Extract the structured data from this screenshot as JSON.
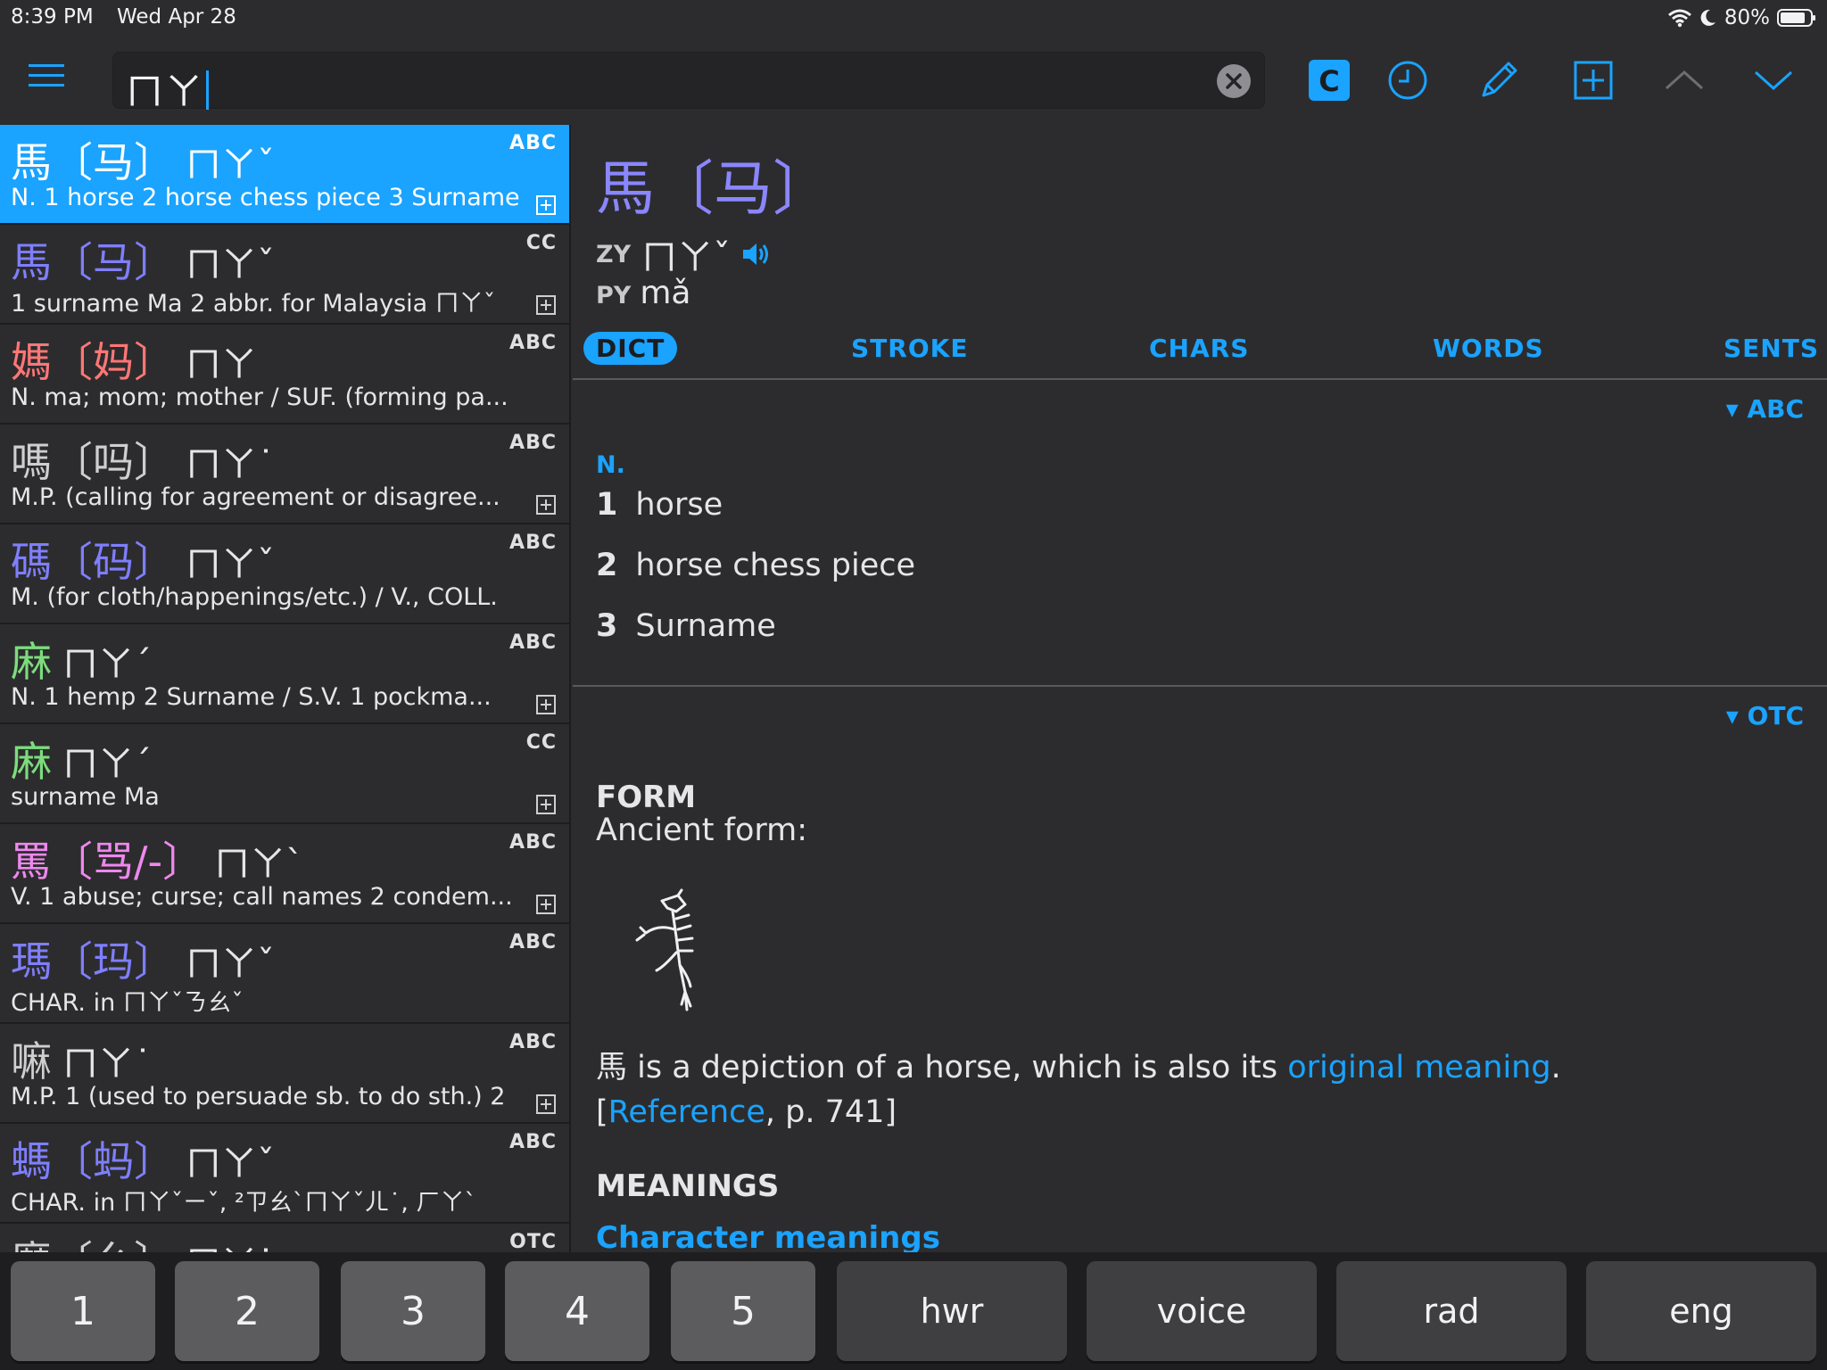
{
  "status": {
    "time": "8:39 PM",
    "date": "Wed Apr 28",
    "battery": "80%"
  },
  "search": {
    "query": "ㄇㄚ"
  },
  "toolbar": {
    "c_label": "C"
  },
  "list": [
    {
      "char": "馬",
      "simp": "〔马〕",
      "zy": "ㄇㄚˇ",
      "src": "ABC",
      "sub": "N. 1 horse 2 horse chess piece 3 Surname",
      "color": "blue",
      "selected": true,
      "add": true
    },
    {
      "char": "馬",
      "simp": "〔马〕",
      "zy": "ㄇㄚˇ",
      "src": "CC",
      "sub": "1 surname Ma 2 abbr. for Malaysia ㄇㄚˇ",
      "color": "blue",
      "add": true
    },
    {
      "char": "媽",
      "simp": "〔妈〕",
      "zy": "ㄇㄚ",
      "src": "ABC",
      "sub": "N. ma; mom; mother / SUF. (forming pa...",
      "color": "red",
      "add": false
    },
    {
      "char": "嗎",
      "simp": "〔吗〕",
      "zy": "ㄇㄚ˙",
      "src": "ABC",
      "sub": "M.P. (calling for agreement or disagree...",
      "color": "gray",
      "add": true
    },
    {
      "char": "碼",
      "simp": "〔码〕",
      "zy": "ㄇㄚˇ",
      "src": "ABC",
      "sub": "M. (for cloth/happenings/etc.) / V., COLL.",
      "color": "blue",
      "add": false
    },
    {
      "char": "麻",
      "simp": "",
      "zy": "ㄇㄚˊ",
      "src": "ABC",
      "sub": "N. 1 hemp 2 Surname / S.V. 1 pockma...",
      "color": "green",
      "add": true
    },
    {
      "char": "麻",
      "simp": "",
      "zy": "ㄇㄚˊ",
      "src": "CC",
      "sub": "surname Ma",
      "color": "green",
      "add": true
    },
    {
      "char": "罵",
      "simp": "〔骂/-〕",
      "zy": "ㄇㄚˋ",
      "src": "ABC",
      "sub": "V. 1 abuse; curse; call names 2 condem...",
      "color": "pink",
      "add": true
    },
    {
      "char": "瑪",
      "simp": "〔玛〕",
      "zy": "ㄇㄚˇ",
      "src": "ABC",
      "sub": "CHAR. in ㄇㄚˇㄋㄠˇ",
      "color": "blue",
      "add": false
    },
    {
      "char": "嘛",
      "simp": "",
      "zy": "ㄇㄚ˙",
      "src": "ABC",
      "sub": "M.P. 1 (used to persuade sb. to do sth.) 2",
      "color": "gray",
      "add": true
    },
    {
      "char": "螞",
      "simp": "〔蚂〕",
      "zy": "ㄇㄚˇ",
      "src": "ABC",
      "sub": "CHAR. in ㄇㄚˇㄧˇ, ²ㄗㄠˋㄇㄚˇㄦ˙, ㄏㄚˋ",
      "color": "blue",
      "add": false
    },
    {
      "char": "麼",
      "simp": "〔么〕",
      "zy": "ㄇㄚ˙",
      "src": "OTC",
      "sub": "",
      "color": "gray",
      "add": false
    }
  ],
  "detail": {
    "head_char": "馬",
    "head_simp": "〔马〕",
    "zy_label": "ZY",
    "zy": "ㄇㄚˇ",
    "py_label": "PY",
    "py": "mǎ",
    "tabs": [
      "DICT",
      "STROKE",
      "CHARS",
      "WORDS",
      "SENTS"
    ],
    "abc_toggle": "▾ ABC",
    "pos": "N.",
    "meanings": [
      {
        "n": "1",
        "text": "horse"
      },
      {
        "n": "2",
        "text": "horse chess piece"
      },
      {
        "n": "3",
        "text": "Surname"
      }
    ],
    "otc_toggle": "▾ OTC",
    "form_heading": "FORM",
    "ancient_form": "Ancient form:",
    "desc_pre": "馬 is a depiction of a horse, which is also its ",
    "desc_link": "original meaning",
    "desc_post": ".",
    "ref_open": "[",
    "ref_link": "Reference",
    "ref_post": ", p. 741]",
    "meanings_heading": "MEANINGS",
    "char_meanings_link": "Character meanings"
  },
  "keyboard": [
    "1",
    "2",
    "3",
    "4",
    "5",
    "hwr",
    "voice",
    "rad",
    "eng"
  ],
  "colors": {
    "accent": "#1aa3ff",
    "bg": "#2c2c2e",
    "head": "#8a86ff"
  }
}
